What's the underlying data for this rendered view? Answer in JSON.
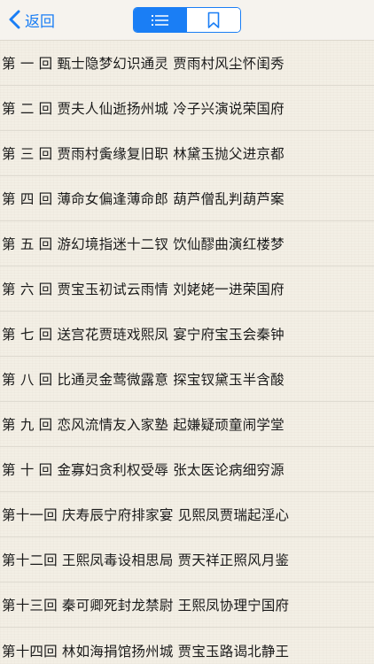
{
  "nav": {
    "back_label": "返回",
    "segments": [
      {
        "icon": "list-icon",
        "active": true
      },
      {
        "icon": "bookmark-icon",
        "active": false
      }
    ],
    "accent_color": "#1a7ef5"
  },
  "chapters": [
    {
      "text": "第 一 回  甄士隐梦幻识通灵  贾雨村风尘怀闺秀"
    },
    {
      "text": "第 二 回  贾夫人仙逝扬州城  冷子兴演说荣国府"
    },
    {
      "text": "第 三 回  贾雨村夤缘复旧职  林黛玉抛父进京都"
    },
    {
      "text": "第 四 回  薄命女偏逢薄命郎  葫芦僧乱判葫芦案"
    },
    {
      "text": "第 五 回  游幻境指迷十二钗  饮仙醪曲演红楼梦"
    },
    {
      "text": "第 六 回  贾宝玉初试云雨情  刘姥姥一进荣国府"
    },
    {
      "text": "第 七 回  送宫花贾琏戏熙凤  宴宁府宝玉会秦钟"
    },
    {
      "text": "第 八 回  比通灵金莺微露意  探宝钗黛玉半含酸"
    },
    {
      "text": "第 九 回  恋风流情友入家塾  起嫌疑顽童闹学堂"
    },
    {
      "text": "第 十 回  金寡妇贪利权受辱  张太医论病细穷源"
    },
    {
      "text": "第十一回  庆寿辰宁府排家宴  见熙凤贾瑞起淫心"
    },
    {
      "text": "第十二回  王熙凤毒设相思局  贾天祥正照风月鉴"
    },
    {
      "text": "第十三回  秦可卿死封龙禁尉  王熙凤协理宁国府"
    },
    {
      "text": "第十四回  林如海捐馆扬州城  贾宝玉路谒北静王"
    }
  ]
}
